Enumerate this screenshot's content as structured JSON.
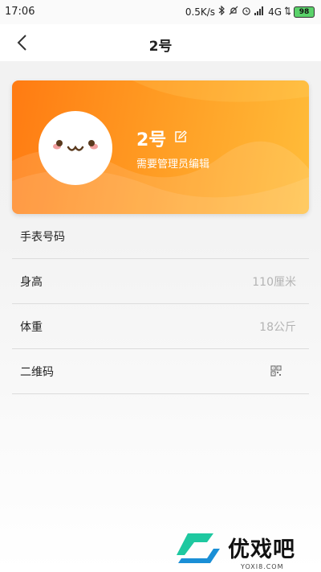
{
  "status_bar": {
    "time": "17:06",
    "speed": "0.5K/s",
    "network": "4G",
    "battery": "98"
  },
  "nav": {
    "title": "2号"
  },
  "profile": {
    "name": "2号",
    "note": "需要管理员编辑",
    "colors": {
      "gradient_start": "#ff7b12",
      "gradient_end": "#ffbd3a"
    }
  },
  "list": {
    "rows": [
      {
        "label": "手表号码",
        "value": ""
      },
      {
        "label": "身高",
        "value": "110厘米"
      },
      {
        "label": "体重",
        "value": "18公斤"
      },
      {
        "label": "二维码",
        "icon": "qr-code-icon"
      }
    ]
  },
  "watermark": {
    "text": "优戏吧",
    "url": "YOXI8.COM"
  }
}
